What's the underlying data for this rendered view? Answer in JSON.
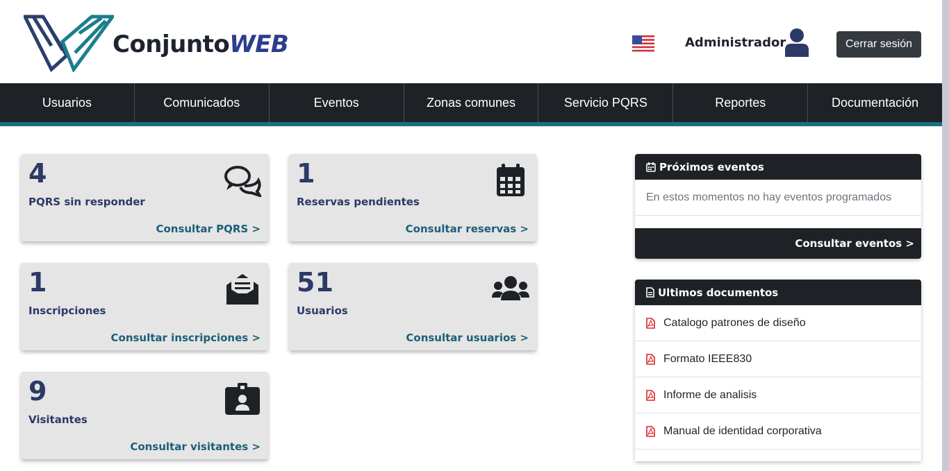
{
  "header": {
    "logo_text_main": "Conjunto",
    "logo_text_accent": "WEB",
    "language_flag": "us-flag-icon",
    "user_name": "Administrador",
    "logout_label": "Cerrar sesión"
  },
  "nav": {
    "items": [
      "Usuarios",
      "Comunicados",
      "Eventos",
      "Zonas comunes",
      "Servicio PQRS",
      "Reportes",
      "Documentación"
    ]
  },
  "cards": [
    {
      "count": "4",
      "label": "PQRS sin responder",
      "link": "Consultar PQRS >",
      "icon": "comments-icon"
    },
    {
      "count": "1",
      "label": "Reservas pendientes",
      "link": "Consultar reservas >",
      "icon": "calendar-icon"
    },
    {
      "count": "1",
      "label": "Inscripciones",
      "link": "Consultar inscripciones >",
      "icon": "envelope-open-icon"
    },
    {
      "count": "51",
      "label": "Usuarios",
      "link": "Consultar usuarios >",
      "icon": "users-icon"
    },
    {
      "count": "9",
      "label": "Visitantes",
      "link": "Consultar visitantes >",
      "icon": "id-badge-icon"
    }
  ],
  "events_panel": {
    "title": "Próximos eventos",
    "empty_message": "En estos momentos no hay eventos programados",
    "footer_link": "Consultar eventos >"
  },
  "docs_panel": {
    "title": "Ultimos documentos",
    "items": [
      "Catalogo patrones de diseño",
      "Formato IEEE830",
      "Informe de analisis",
      "Manual de identidad corporativa"
    ]
  },
  "colors": {
    "nav_bg": "#1e2125",
    "accent": "#1b6f7c",
    "card_bg": "#e5e5e5",
    "card_text": "#2b3a67",
    "link": "#1b5f78",
    "pdf_red": "#d9252a"
  }
}
